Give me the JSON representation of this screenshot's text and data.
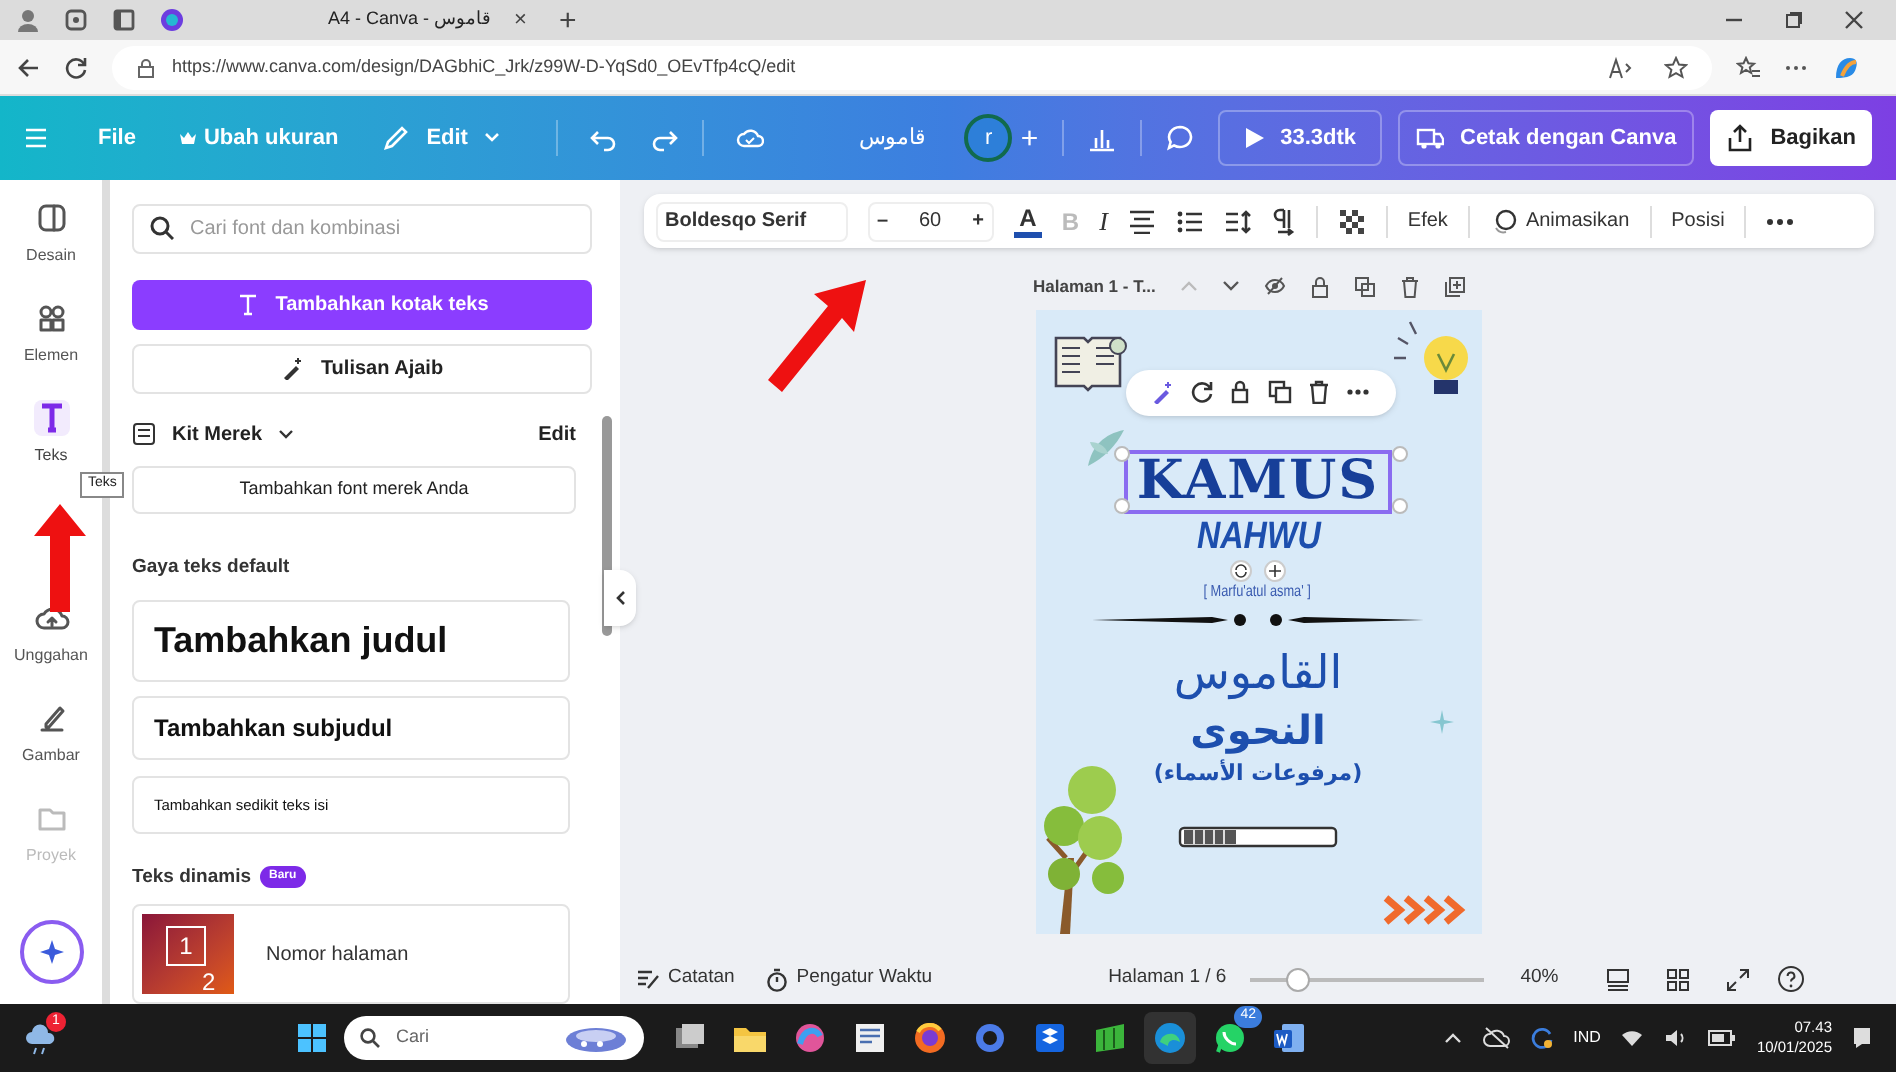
{
  "browser": {
    "tab_title": "A4 - Canva - قاموس",
    "tab_close": "×",
    "new_tab": "+",
    "url": "https://www.canva.com/design/DAGbhiC_Jrk/z99W-D-YqSd0_OEvTfp4cQ/edit"
  },
  "topbar": {
    "menu": [
      "File",
      "Ubah ukuran",
      "Edit"
    ],
    "design_title": "قاموس",
    "avatar": "r",
    "add": "+",
    "timer": "33.3dtk",
    "print": "Cetak dengan Canva",
    "share": "Bagikan"
  },
  "rail": [
    {
      "label": "Desain",
      "selected": false,
      "disabled": false
    },
    {
      "label": "Elemen",
      "selected": false,
      "disabled": false
    },
    {
      "label": "Teks",
      "selected": true,
      "disabled": false
    },
    {
      "label": "Unggahan",
      "selected": false,
      "disabled": false
    },
    {
      "label": "Gambar",
      "selected": false,
      "disabled": false
    },
    {
      "label": "Proyek",
      "selected": false,
      "disabled": true
    }
  ],
  "tooltip": "Teks",
  "panel": {
    "search_placeholder": "Cari font dan kombinasi",
    "add_textbox": "Tambahkan kotak teks",
    "magic_write": "Tulisan Ajaib",
    "brand_kit": {
      "label": "Kit Merek",
      "edit": "Edit",
      "add_font": "Tambahkan font merek Anda"
    },
    "default_styles": {
      "heading": "Gaya teks default",
      "items": [
        {
          "kind": "title",
          "label": "Tambahkan judul"
        },
        {
          "kind": "subtitle",
          "label": "Tambahkan subjudul"
        },
        {
          "kind": "body",
          "label": "Tambahkan sedikit teks isi"
        }
      ]
    },
    "dynamic": {
      "heading": "Teks dinamis",
      "badge": "Baru",
      "item": "Nomor halaman",
      "thumb_labels": [
        "1",
        "2"
      ]
    }
  },
  "toolbar": {
    "font": "Boldesqo Serif",
    "minus": "–",
    "size": "60",
    "plus": "+",
    "color_letter": "A",
    "bold": "B",
    "bold_disabled": true,
    "italic": "I",
    "effects": "Efek",
    "animate": "Animasikan",
    "position": "Posisi"
  },
  "page_header": "Halaman 1 - T...",
  "page": {
    "title": "KAMUS",
    "title_selected": true,
    "subtitle": "NAHWU",
    "note": "[ Marfu'atul asma' ]",
    "arabic": [
      "القاموس",
      "النحوى",
      "(مرفوعات الأسماء)"
    ]
  },
  "bottombar": {
    "notes": "Catatan",
    "timer": "Pengatur Waktu",
    "page": "Halaman 1 / 6",
    "level": 0.2,
    "zoom": "40%"
  },
  "taskbar": {
    "weather_badge": "1",
    "search_placeholder": "Cari",
    "chat_badge": "42",
    "language": "IND",
    "time": "07.43",
    "date": "10/01/2025"
  }
}
